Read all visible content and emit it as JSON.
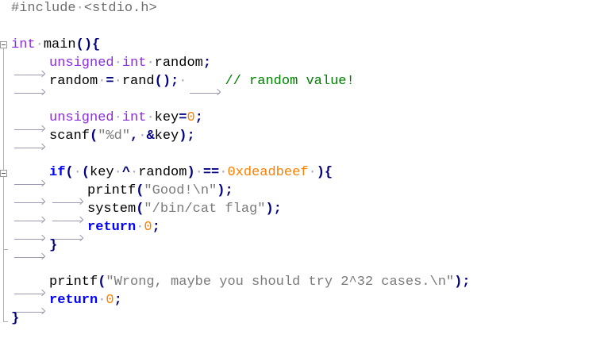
{
  "code": {
    "include_directive": "#include",
    "include_header": "<stdio.h>",
    "kw_int": "int",
    "kw_unsigned": "unsigned",
    "kw_if": "if",
    "kw_return": "return",
    "fn_main": "main",
    "var_random": "random",
    "var_key": "key",
    "fn_rand": "rand",
    "fn_scanf": "scanf",
    "fn_printf": "printf",
    "fn_system": "system",
    "comment_random": "// random value!",
    "fmt_d": "\"%d\"",
    "str_good": "\"Good!\\n\"",
    "str_cat": "\"/bin/cat flag\"",
    "str_wrong": "\"Wrong, maybe you should try 2^32 cases.\\n\"",
    "num_zero": "0",
    "num_hex": "0xdeadbeef"
  },
  "colors": {
    "preprocessor": "#6e6e6e",
    "type_keyword": "#8b2be2",
    "control_keyword": "#0000ff",
    "operator": "#000080",
    "number": "#ff8000",
    "string": "#7a7a7a",
    "comment": "#008000",
    "whitespace_marker": "#9a9ab0"
  }
}
